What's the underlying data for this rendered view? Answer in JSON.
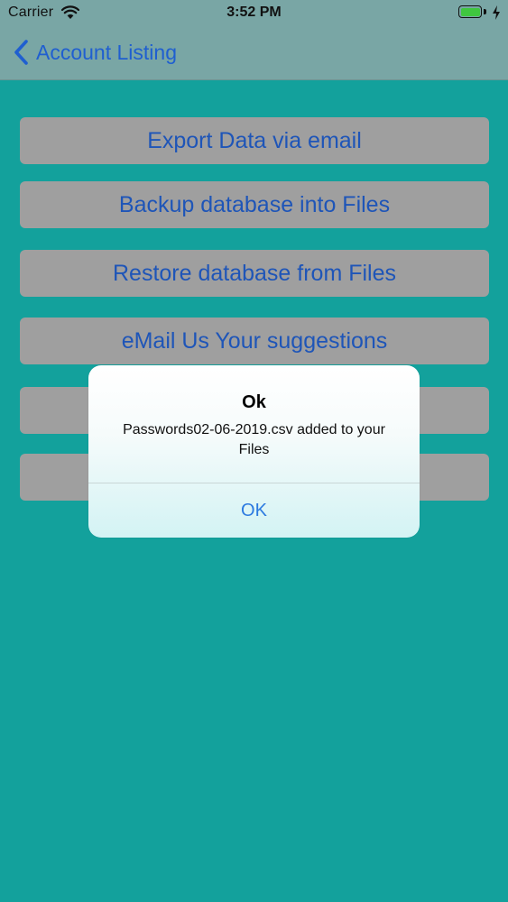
{
  "status_bar": {
    "carrier": "Carrier",
    "time": "3:52 PM",
    "battery_color": "#3fc63f"
  },
  "nav": {
    "back_label": "Account Listing",
    "back_icon": "chevron-left-icon"
  },
  "menu": {
    "buttons": [
      {
        "label": "Export Data via email"
      },
      {
        "label": "Backup database into Files"
      },
      {
        "label": "Restore database from Files"
      },
      {
        "label": "eMail Us Your suggestions"
      },
      {
        "label": ""
      },
      {
        "label": ""
      }
    ]
  },
  "alert": {
    "title": "Ok",
    "message": "Passwords02-06-2019.csv added to your Files",
    "ok_label": "OK"
  },
  "colors": {
    "background": "#13a19c",
    "button": "#9f9f9f",
    "button_text": "#1e55b8",
    "alert_action": "#2c7ae0"
  }
}
